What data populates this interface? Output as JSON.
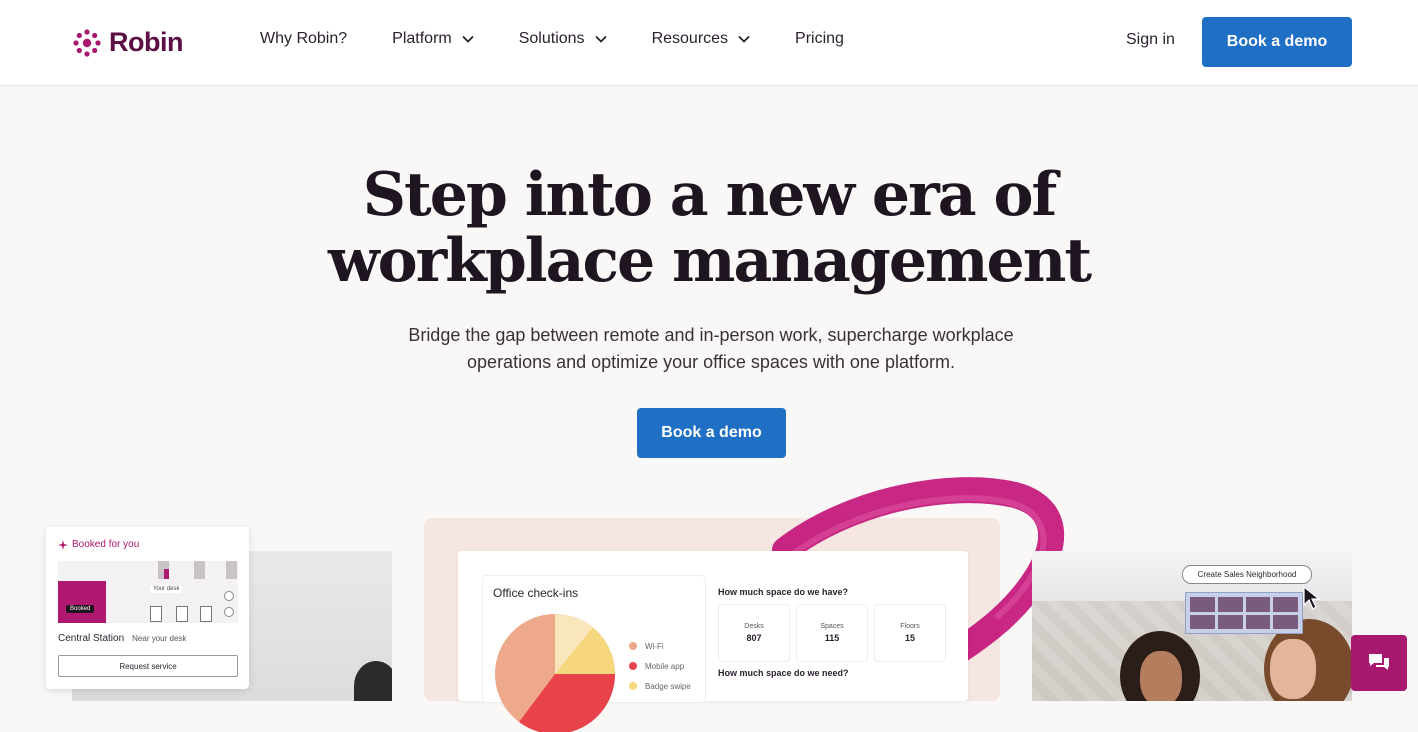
{
  "brand": {
    "name": "Robin",
    "color": "#a8186e",
    "logo_icon": "robin-dots-logo"
  },
  "nav": {
    "items": [
      {
        "label": "Why Robin?",
        "dropdown": false
      },
      {
        "label": "Platform",
        "dropdown": true
      },
      {
        "label": "Solutions",
        "dropdown": true
      },
      {
        "label": "Resources",
        "dropdown": true
      },
      {
        "label": "Pricing",
        "dropdown": false
      }
    ],
    "sign_in": "Sign in",
    "cta": "Book a demo"
  },
  "hero": {
    "title_line1": "Step into a new era of",
    "title_line2": "workplace management",
    "subtitle_line1": "Bridge the gap between remote and in-person work, supercharge workplace",
    "subtitle_line2": "operations and optimize your office spaces with one platform.",
    "cta": "Book a demo",
    "accent_color": "#1f6fc5"
  },
  "booked_card": {
    "header": "Booked for you",
    "booked_chip": "Booked",
    "desk_label": "Your desk",
    "location": "Central Station",
    "location_sub": "Near your desk",
    "button": "Request service"
  },
  "dashboard": {
    "checkins_title": "Office check-ins",
    "legend": [
      {
        "label": "Wi-Fi",
        "color": "#eea88a"
      },
      {
        "label": "Mobile app",
        "color": "#e8424b"
      },
      {
        "label": "Badge swipe",
        "color": "#f6d77e"
      }
    ],
    "question1": "How much space do we have?",
    "stats": [
      {
        "label": "Desks",
        "value": "807"
      },
      {
        "label": "Spaces",
        "value": "115"
      },
      {
        "label": "Floors",
        "value": "15"
      }
    ],
    "question2": "How much space do we need?"
  },
  "neighborhood": {
    "pill": "Create Sales Neighborhood"
  },
  "chat": {
    "icon": "chat-bubbles-icon"
  }
}
